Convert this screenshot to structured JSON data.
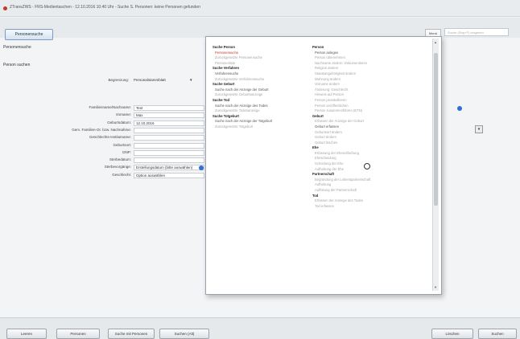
{
  "window": {
    "title": "ZTransZWS - FRS-Medientaschen - 12.10.2016 10:40 Uhr - Suche S. Personen: keine Personen gefunden"
  },
  "toolbar": {
    "tab_label": "Personensuche",
    "menu_label": "Menü",
    "search_placeholder": "Suche (Strg+F) eingeben"
  },
  "breadcrumb": {
    "section": "Personensuche",
    "subsection": "Person suchen"
  },
  "form": {
    "bezugsweg_label": "Begrenzung:",
    "bezugsweg_value": "Personalstammblatt",
    "fields": [
      {
        "label": "Familienname/Nachname:",
        "value": "Test"
      },
      {
        "label": "Vorname:",
        "value": "Max"
      },
      {
        "label": "Geburtsdatum:",
        "value": "12.10.2016"
      },
      {
        "label": "Gem. Familien-Or. bzw. Nachnahme:",
        "value": ""
      },
      {
        "label": "Geschlechts-Institutname:",
        "value": ""
      },
      {
        "label": "Geburtsort:",
        "value": ""
      },
      {
        "label": "DNP:",
        "value": ""
      },
      {
        "label": "Sterbedatum:",
        "value": ""
      },
      {
        "label": "Sterbevorgänge:",
        "value": "Erstellungsdatum (bitte auswählen)"
      },
      {
        "label": "Geschlecht:",
        "value": "Option auswählen"
      }
    ]
  },
  "popup": {
    "col1": [
      {
        "text": "Suche Person",
        "kind": "h"
      },
      {
        "text": "Personensuche",
        "kind": "sel"
      },
      {
        "text": "Zurückgesetzte Personensuche",
        "kind": "d"
      },
      {
        "text": "Personenliste",
        "kind": "d"
      },
      {
        "text": "Suche Verfahren",
        "kind": "h"
      },
      {
        "text": "Verfahrensuche",
        "kind": "n"
      },
      {
        "text": "Zurückgesetzte Verfahrenssuche",
        "kind": "d"
      },
      {
        "text": "Suche Geburt",
        "kind": "h"
      },
      {
        "text": "Suche nach der Anzeige der Geburt",
        "kind": "n"
      },
      {
        "text": "Zurückgesetzte Geburtsanzeige",
        "kind": "d"
      },
      {
        "text": "Suche Tod",
        "kind": "h"
      },
      {
        "text": "Suche nach der Anzeige des Todes",
        "kind": "n"
      },
      {
        "text": "Zurückgesetzte Todesanzeige",
        "kind": "d"
      },
      {
        "text": "Suche Totgeburt",
        "kind": "h"
      },
      {
        "text": "Suche nach der Anzeige der Totgeburt",
        "kind": "n"
      },
      {
        "text": "Zurückgesetzte Totgeburt",
        "kind": "d"
      }
    ],
    "col2": [
      {
        "text": "Person",
        "kind": "h"
      },
      {
        "text": "Person anlegen",
        "kind": "n"
      },
      {
        "text": "Person übernehmen",
        "kind": "d"
      },
      {
        "text": "Nachname ändern: Dokumentieren",
        "kind": "d"
      },
      {
        "text": "Religion ändern",
        "kind": "d"
      },
      {
        "text": "Staatsangehörigkeit ändern",
        "kind": "d"
      },
      {
        "text": "Wohnung ändern",
        "kind": "d"
      },
      {
        "text": "Vorname ändern",
        "kind": "d"
      },
      {
        "text": "Änderung: Geschlecht",
        "kind": "d"
      },
      {
        "text": "Hinweis auf Person",
        "kind": "d"
      },
      {
        "text": "Person protokollieren",
        "kind": "d"
      },
      {
        "text": "Person veröffentlichen",
        "kind": "d"
      },
      {
        "text": "Person zusammenführen (ETN)",
        "kind": "d"
      },
      {
        "text": "Geburt",
        "kind": "h"
      },
      {
        "text": "Erfassen der Anzeige der Geburt",
        "kind": "d"
      },
      {
        "text": "Geburt erfassen",
        "kind": "n"
      },
      {
        "text": "Geburtsort ändern",
        "kind": "d"
      },
      {
        "text": "Geburt ändern",
        "kind": "d"
      },
      {
        "text": "Geburt löschen",
        "kind": "d"
      },
      {
        "text": "Ehe",
        "kind": "h"
      },
      {
        "text": "Erfassung der Eheschließung",
        "kind": "d"
      },
      {
        "text": "Ehescheidung",
        "kind": "d"
      },
      {
        "text": "Scheidung der Ehe",
        "kind": "d"
      },
      {
        "text": "Aufhebung der Ehe",
        "kind": "d"
      },
      {
        "text": "Partnerschaft",
        "kind": "h"
      },
      {
        "text": "Begründung der Lebenspartnerschaft",
        "kind": "d"
      },
      {
        "text": "Aufhebung",
        "kind": "d"
      },
      {
        "text": "Auflösung der Partnerschaft",
        "kind": "d"
      },
      {
        "text": "Tod",
        "kind": "h"
      },
      {
        "text": "Erfassen der Anzeige des Todes",
        "kind": "d"
      },
      {
        "text": "Tod erfassen",
        "kind": "d"
      }
    ]
  },
  "bottom": {
    "btn1": "Leeren",
    "btn2": "Personen",
    "btn3": "Suche mit Personen",
    "btn4": "Suchen (Alt)",
    "btn_right1": "Löschen",
    "btn_right2": "Suchen"
  }
}
